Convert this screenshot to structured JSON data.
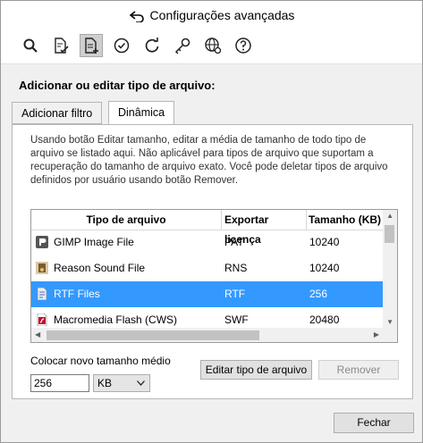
{
  "window": {
    "title": "Configurações avançadas"
  },
  "toolbar": {
    "items": [
      {
        "icon": "search-icon",
        "active": false
      },
      {
        "icon": "document-check-icon",
        "active": false
      },
      {
        "icon": "document-edit-icon",
        "active": true
      },
      {
        "icon": "clock-check-icon",
        "active": false
      },
      {
        "icon": "refresh-icon",
        "active": false
      },
      {
        "icon": "key-icon",
        "active": false
      },
      {
        "icon": "globe-gear-icon",
        "active": false
      },
      {
        "icon": "help-icon",
        "active": false
      }
    ]
  },
  "section": {
    "title": "Adicionar ou editar tipo de arquivo:"
  },
  "tabs": [
    {
      "label": "Adicionar filtro",
      "selected": false
    },
    {
      "label": "Dinâmica",
      "selected": true
    }
  ],
  "panel": {
    "description": "Usando botão Editar tamanho, editar a média de tamanho de todo tipo de arquivo se listado aqui. Não aplicável para tipos de arquivo que suportam a recuperação do tamanho de arquivo exato. Você pode deletar tipos de arquivo definidos por usuário usando botão Remover."
  },
  "table": {
    "columns": [
      "Tipo de arquivo",
      "Exportar licença",
      "Tamanho (KB)"
    ],
    "rows": [
      {
        "name": "GIMP Image File",
        "ext": "PAT",
        "size": "10240",
        "icon": "gimp-file-icon",
        "selected": false
      },
      {
        "name": "Reason Sound File",
        "ext": "RNS",
        "size": "10240",
        "icon": "sound-file-icon",
        "selected": false
      },
      {
        "name": "RTF Files",
        "ext": "RTF",
        "size": "256",
        "icon": "rtf-file-icon",
        "selected": true
      },
      {
        "name": "Macromedia Flash (CWS)",
        "ext": "SWF",
        "size": "20480",
        "icon": "flash-file-icon",
        "selected": false
      }
    ]
  },
  "avg": {
    "label": "Colocar novo tamanho médio",
    "value": "256",
    "unit": "KB"
  },
  "buttons": {
    "edit": "Editar tipo de arquivo",
    "remove": "Remover",
    "close": "Fechar"
  },
  "colors": {
    "selection": "#3399ff"
  }
}
